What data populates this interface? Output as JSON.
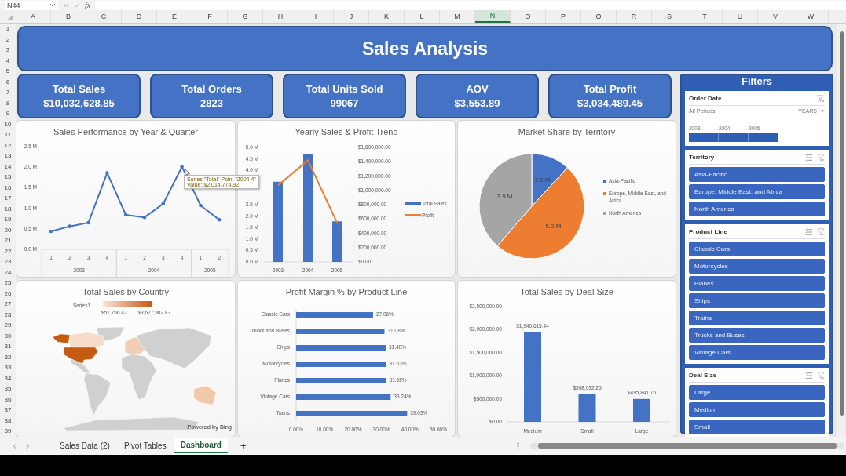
{
  "formula_bar": {
    "name_box": "N44",
    "function_label": "fx"
  },
  "column_headers": [
    {
      "label": "A",
      "selected": false
    },
    {
      "label": "B",
      "selected": false
    },
    {
      "label": "C",
      "selected": false
    },
    {
      "label": "D",
      "selected": false
    },
    {
      "label": "E",
      "selected": false
    },
    {
      "label": "F",
      "selected": false
    },
    {
      "label": "G",
      "selected": false
    },
    {
      "label": "H",
      "selected": false
    },
    {
      "label": "I",
      "selected": false
    },
    {
      "label": "J",
      "selected": false
    },
    {
      "label": "K",
      "selected": false
    },
    {
      "label": "L",
      "selected": false
    },
    {
      "label": "M",
      "selected": false
    },
    {
      "label": "N",
      "selected": true
    },
    {
      "label": "O",
      "selected": false
    },
    {
      "label": "P",
      "selected": false
    },
    {
      "label": "Q",
      "selected": false
    },
    {
      "label": "R",
      "selected": false
    },
    {
      "label": "S",
      "selected": false
    },
    {
      "label": "T",
      "selected": false
    },
    {
      "label": "U",
      "selected": false
    },
    {
      "label": "V",
      "selected": false
    },
    {
      "label": "W",
      "selected": false
    }
  ],
  "row_headers": [
    "1",
    "2",
    "3",
    "4",
    "5",
    "6",
    "7",
    "8",
    "9",
    "10",
    "11",
    "12",
    "13",
    "14",
    "15",
    "16",
    "17",
    "18",
    "19",
    "20",
    "21",
    "22",
    "23",
    "24",
    "25",
    "26",
    "27",
    "28",
    "29",
    "30",
    "31",
    "32",
    "33",
    "34",
    "35",
    "36",
    "37",
    "38",
    "39"
  ],
  "dashboard": {
    "title": "Sales Analysis",
    "kpis": [
      {
        "label": "Total Sales",
        "value": "$10,032,628.85"
      },
      {
        "label": "Total Orders",
        "value": "2823"
      },
      {
        "label": "Total Units Sold",
        "value": "99067"
      },
      {
        "label": "AOV",
        "value": "$3,553.89"
      },
      {
        "label": "Total Profit",
        "value": "$3,034,489.45"
      }
    ],
    "charts": [
      {
        "chart_data": {
          "type": "line",
          "title": "Sales Performance by Year & Quarter",
          "series": [
            {
              "color": "#4472c4",
              "values": [
                440000,
                560000,
                650000,
                1860000,
                840000,
                780000,
                1110000,
                2010000,
                1070000,
                720000
              ]
            }
          ],
          "ylim": [
            0,
            2500000
          ],
          "yticks": [
            {
              "value": 0,
              "label": "0.0 M"
            },
            {
              "value": 500000,
              "label": "0.5 M"
            },
            {
              "value": 1000000,
              "label": "1.0 M"
            },
            {
              "value": 1500000,
              "label": "1.5 M"
            },
            {
              "value": 2000000,
              "label": "2.0 M"
            },
            {
              "value": 2500000,
              "label": "2.5 M"
            }
          ]
        },
        "category_groups": [
          {
            "label": "2003",
            "categories": [
              "1",
              "2",
              "3",
              "4"
            ]
          },
          {
            "label": "2004",
            "categories": [
              "1",
              "2",
              "3",
              "4"
            ]
          },
          {
            "label": "2005",
            "categories": [
              "1",
              "2"
            ]
          }
        ],
        "tooltip": [
          "Series \"Total\" Point \"2004 4\"",
          "Value: $2,014,774.92"
        ]
      },
      {
        "chart_data": {
          "type": "bar",
          "title": "Yearly Sales & Profit Trend",
          "stacked": false,
          "legend": "right",
          "categories": [
            "2003",
            "2004",
            "2005"
          ],
          "series": [
            {
              "name": "Total Sales",
              "type": "bar",
              "color": "#4472c4",
              "values": [
                3500000,
                4720000,
                1770000
              ]
            },
            {
              "name": "Profit",
              "type": "line",
              "axis": "y2",
              "color": "#ed7d31",
              "values": [
                1070000,
                1420000,
                550000
              ]
            }
          ],
          "ylim": [
            0,
            5000000
          ],
          "yticks": [
            {
              "value": 0,
              "label": "0.0 M"
            },
            {
              "value": 500000,
              "label": "0.5 M"
            },
            {
              "value": 1000000,
              "label": "1.0 M"
            },
            {
              "value": 1500000,
              "label": "1.5 M"
            },
            {
              "value": 2000000,
              "label": "2.0 M"
            },
            {
              "value": 2500000,
              "label": "2.5 M"
            },
            {
              "value": 4000000,
              "label": "4.0 M"
            },
            {
              "value": 4500000,
              "label": "4.5 M"
            },
            {
              "value": 5000000,
              "label": "5.0 M"
            }
          ],
          "y2lim": [
            0,
            1600000
          ],
          "y2ticks": [
            {
              "value": 0,
              "label": "$0.00"
            },
            {
              "value": 200000,
              "label": "$200,000.00"
            },
            {
              "value": 400000,
              "label": "$400,000.00"
            },
            {
              "value": 600000,
              "label": "$600,000.00"
            },
            {
              "value": 800000,
              "label": "$800,000.00"
            },
            {
              "value": 1000000,
              "label": "$1,000,000.00"
            },
            {
              "value": 1200000,
              "label": "$1,200,000.00"
            },
            {
              "value": 1400000,
              "label": "$1,400,000.00"
            },
            {
              "value": 1600000,
              "label": "$1,600,000.00"
            }
          ]
        }
      },
      {
        "chart_data": {
          "type": "pie",
          "title": "Market Share by Territory",
          "categories": [
            "Asia-Pacific",
            "Europe, Middle East, and Africa",
            "North America"
          ],
          "values": [
            1.2,
            5.0,
            3.9
          ],
          "colors": [
            "#4472c4",
            "#ed7d31",
            "#a5a5a5"
          ],
          "value_labels": [
            "1.2 M",
            "5.0 M",
            "3.9 M"
          ]
        }
      },
      {
        "title": "Total Sales by Country",
        "legend": {
          "series": "Series1",
          "min": "$57,756.43",
          "max": "$3,627,982.83"
        },
        "attribution": "Powered by Bing"
      },
      {
        "chart_data": {
          "type": "bar",
          "orientation": "horizontal",
          "title": "Profit Margin % by Product Line",
          "categories": [
            "Classic Cars",
            "Trucks and Buses",
            "Ships",
            "Motorcycles",
            "Planes",
            "Vintage Cars",
            "Trains"
          ],
          "values": [
            27.06,
            31.08,
            31.48,
            31.63,
            31.65,
            33.24,
            39.03
          ],
          "value_labels": [
            "27.06%",
            "31.08%",
            "31.48%",
            "31.63%",
            "31.65%",
            "33.24%",
            "39.03%"
          ],
          "xlim": [
            0,
            50
          ],
          "xticks": [
            {
              "value": 0,
              "label": "0.00%"
            },
            {
              "value": 10,
              "label": "10.00%"
            },
            {
              "value": 20,
              "label": "20.00%"
            },
            {
              "value": 30,
              "label": "30.00%"
            },
            {
              "value": 40,
              "label": "40.00%"
            },
            {
              "value": 50,
              "label": "50.00%"
            }
          ]
        }
      },
      {
        "chart_data": {
          "type": "bar",
          "orientation": "vertical",
          "title": "Total Sales by Deal Size",
          "categories": [
            "Medium",
            "Small",
            "Large"
          ],
          "values": [
            1940615.44,
            598032.25,
            495841.76
          ],
          "value_labels": [
            "$1,940,615.44",
            "$598,032.25",
            "$495,841.76"
          ],
          "ylim": [
            0,
            2500000
          ],
          "yticks": [
            {
              "value": 0,
              "label": "$0.00"
            },
            {
              "value": 500000,
              "label": "$500,000.00"
            },
            {
              "value": 1000000,
              "label": "$1,000,000.00"
            },
            {
              "value": 1500000,
              "label": "$1,500,000.00"
            },
            {
              "value": 2000000,
              "label": "$2,000,000.00"
            },
            {
              "value": 2500000,
              "label": "$2,500,000.00"
            }
          ]
        }
      }
    ],
    "filters": {
      "title": "Filters",
      "timeline": {
        "title": "Order Date",
        "range_label": "All Periods",
        "level_label": "YEARS",
        "periods": [
          {
            "label": "2003",
            "selected": true
          },
          {
            "label": "2004",
            "selected": true
          },
          {
            "label": "2005",
            "selected": true
          }
        ]
      },
      "slicers": [
        {
          "title": "Territory",
          "items": [
            {
              "label": "Asia-Pacific",
              "selected": true
            },
            {
              "label": "Europe, Middle East, and Africa",
              "selected": true
            },
            {
              "label": "North America",
              "selected": true
            }
          ]
        },
        {
          "title": "Product Line",
          "items": [
            {
              "label": "Classic Cars",
              "selected": true
            },
            {
              "label": "Motorcycles",
              "selected": true
            },
            {
              "label": "Planes",
              "selected": true
            },
            {
              "label": "Ships",
              "selected": true
            },
            {
              "label": "Trains",
              "selected": true
            },
            {
              "label": "Trucks and Buses",
              "selected": true
            },
            {
              "label": "Vintage Cars",
              "selected": true
            }
          ]
        },
        {
          "title": "Deal Size",
          "items": [
            {
              "label": "Large",
              "selected": true
            },
            {
              "label": "Medium",
              "selected": true
            },
            {
              "label": "Small",
              "selected": true
            }
          ]
        }
      ]
    }
  },
  "sheet_tabs": [
    {
      "label": "Sales Data (2)",
      "selected": false
    },
    {
      "label": "Pivot Tables",
      "selected": false
    },
    {
      "label": "Dashboard",
      "selected": true
    }
  ],
  "new_sheet_button": "+"
}
